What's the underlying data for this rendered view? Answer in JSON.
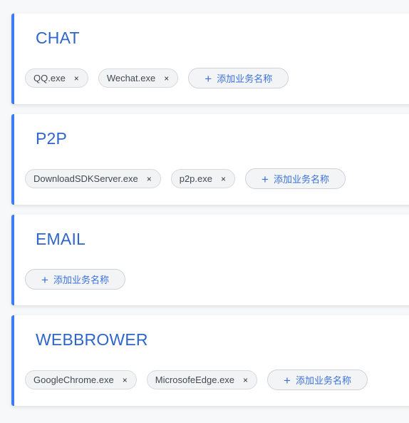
{
  "groups": [
    {
      "title": "CHAT",
      "tags": [
        "QQ.exe",
        "Wechat.exe"
      ],
      "add_label": "添加业务名称"
    },
    {
      "title": "P2P",
      "tags": [
        "DownloadSDKServer.exe",
        "p2p.exe"
      ],
      "add_label": "添加业务名称"
    },
    {
      "title": "EMAIL",
      "tags": [],
      "add_label": "添加业务名称"
    },
    {
      "title": "WEBBROWER",
      "tags": [
        "GoogleChrome.exe",
        "MicrosofeEdge.exe"
      ],
      "add_label": "添加业务名称"
    }
  ],
  "icons": {
    "close": "×",
    "add": "+"
  },
  "colors": {
    "accent": "#3d7af5",
    "title": "#2f66c9",
    "add_text": "#3b72d8",
    "tag_bg": "#f2f3f5"
  }
}
